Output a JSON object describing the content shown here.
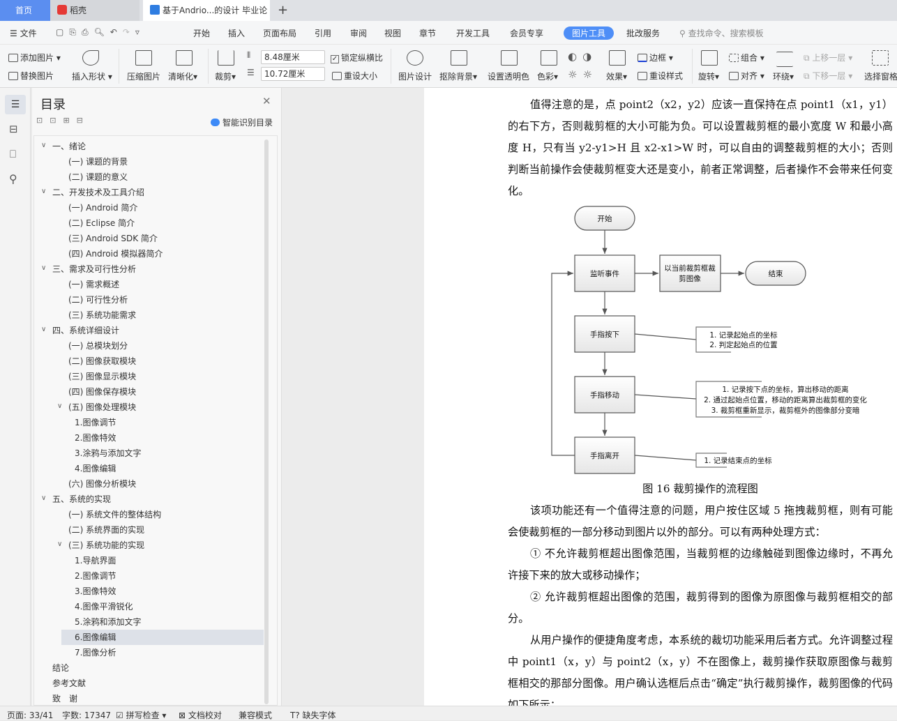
{
  "tabs": [
    {
      "label": "首页"
    },
    {
      "label": "稻壳"
    },
    {
      "label": "基于Andrio...的设计 毕业论文"
    }
  ],
  "new_tab": "+",
  "menu": {
    "file": "文件",
    "items": [
      "开始",
      "插入",
      "页面布局",
      "引用",
      "审阅",
      "视图",
      "章节",
      "开发工具",
      "会员专享",
      "图片工具",
      "批改服务"
    ],
    "active": "图片工具",
    "search_placeholder": "查找命令、搜索模板"
  },
  "ribbon": {
    "add_image": "添加图片",
    "replace_image": "替换图片",
    "insert_shape": "插入形状",
    "compress": "压缩图片",
    "sharpen": "清晰化",
    "crop": "裁剪",
    "width": "8.48厘米",
    "height": "10.72厘米",
    "lock_ratio": "锁定纵横比",
    "lock_ratio_checked": true,
    "reset_size": "重设大小",
    "image_design": "图片设计",
    "remove_bg": "抠除背景",
    "set_transparent": "设置透明色",
    "color": "色彩",
    "effects": "效果",
    "border": "边框",
    "reset_style": "重设样式",
    "rotate": "旋转",
    "group": "组合",
    "align": "对齐",
    "wrap": "环绕",
    "bring_forward": "上移一层",
    "send_backward": "下移一层",
    "selection_pane": "选择窗格"
  },
  "toc": {
    "title": "目录",
    "smart": "智能识别目录",
    "items": [
      {
        "label": "一、绪论",
        "level": 1,
        "expanded": true
      },
      {
        "label": "(一) 课题的背景",
        "level": 2
      },
      {
        "label": "(二) 课题的意义",
        "level": 2
      },
      {
        "label": "二、开发技术及工具介绍",
        "level": 1,
        "expanded": true
      },
      {
        "label": "(一) Android 简介",
        "level": 2
      },
      {
        "label": "(二) Eclipse 简介",
        "level": 2
      },
      {
        "label": "(三) Android SDK 简介",
        "level": 2
      },
      {
        "label": "(四) Android 模拟器简介",
        "level": 2
      },
      {
        "label": "三、需求及可行性分析",
        "level": 1,
        "expanded": true
      },
      {
        "label": "(一) 需求概述",
        "level": 2
      },
      {
        "label": "(二) 可行性分析",
        "level": 2
      },
      {
        "label": "(三) 系统功能需求",
        "level": 2
      },
      {
        "label": "四、系统详细设计",
        "level": 1,
        "expanded": true
      },
      {
        "label": "(一) 总模块划分",
        "level": 2
      },
      {
        "label": "(二) 图像获取模块",
        "level": 2
      },
      {
        "label": "(三) 图像显示模块",
        "level": 2
      },
      {
        "label": "(四) 图像保存模块",
        "level": 2
      },
      {
        "label": "(五) 图像处理模块",
        "level": 2,
        "expanded": true
      },
      {
        "label": "1.图像调节",
        "level": 3
      },
      {
        "label": "2.图像特效",
        "level": 3
      },
      {
        "label": "3.涂鸦与添加文字",
        "level": 3
      },
      {
        "label": "4.图像编辑",
        "level": 3
      },
      {
        "label": "(六) 图像分析模块",
        "level": 2
      },
      {
        "label": "五、系统的实现",
        "level": 1,
        "expanded": true
      },
      {
        "label": "(一) 系统文件的整体结构",
        "level": 2
      },
      {
        "label": "(二) 系统界面的实现",
        "level": 2
      },
      {
        "label": "(三) 系统功能的实现",
        "level": 2,
        "expanded": true
      },
      {
        "label": "1.导航界面",
        "level": 3
      },
      {
        "label": "2.图像调节",
        "level": 3
      },
      {
        "label": "3.图像特效",
        "level": 3
      },
      {
        "label": "4.图像平滑锐化",
        "level": 3
      },
      {
        "label": "5.涂鸦和添加文字",
        "level": 3
      },
      {
        "label": "6.图像编辑",
        "level": 3,
        "selected": true
      },
      {
        "label": "7.图像分析",
        "level": 3
      },
      {
        "label": "结论",
        "level": 1
      },
      {
        "label": "参考文献",
        "level": 1
      },
      {
        "label": "致　谢",
        "level": 1
      }
    ]
  },
  "document": {
    "p1": "值得注意的是，点 point2（x2，y2）应该一直保持在点 point1（x1，y1）的右下方，否则裁剪框的大小可能为负。可以设置裁剪框的最小宽度 W 和最小高度 H，只有当 y2-y1>H 且 x2-x1>W 时，可以自由的调整裁剪框的大小；否则判断当前操作会使裁剪框变大还是变小，前者正常调整，后者操作不会带来任何变化。",
    "caption": "图 16  裁剪操作的流程图",
    "p2": "该项功能还有一个值得注意的问题，用户按住区域 5 拖拽裁剪框，则有可能会使裁剪框的一部分移动到图片以外的部分。可以有两种处理方式：",
    "p3": "① 不允许裁剪框超出图像范围，当裁剪框的边缘触碰到图像边缘时，不再允许接下来的放大或移动操作；",
    "p4": "② 允许裁剪框超出图像的范围，裁剪得到的图像为原图像与裁剪框相交的部分。",
    "p5": "从用户操作的便捷角度考虑，本系统的裁切功能采用后者方式。允许调整过程中 point1（x，y）与 point2（x，y）不在图像上，裁剪操作获取原图像与裁剪框相交的那部分图像。用户确认选框后点击“确定”执行裁剪操作，裁剪图像的代码如下所示："
  },
  "flowchart": {
    "start": "开始",
    "listen": "监听事件",
    "crop": [
      "以当前裁剪框裁",
      "剪图像"
    ],
    "end": "结束",
    "down": "手指按下",
    "move": "手指移动",
    "up": "手指离开",
    "note_down": [
      "1. 记录起始点的坐标",
      "2. 判定起始点的位置"
    ],
    "note_move": [
      "1. 记录按下点的坐标，算出移动的距离",
      "2. 通过起始点位置，移动的距离算出裁剪框的变化",
      "3. 裁剪框重新显示，裁剪框外的图像部分变暗"
    ],
    "note_up": [
      "1. 记录结束点的坐标"
    ]
  },
  "status": {
    "page": "页面: 33/41",
    "words": "字数: 17347",
    "spell": "拼写检查",
    "proof": "文档校对",
    "compat": "兼容模式",
    "missing_font": "缺失字体"
  },
  "colors": {
    "accent": "#4e8ef7",
    "home_tab": "#5b8ef0"
  }
}
